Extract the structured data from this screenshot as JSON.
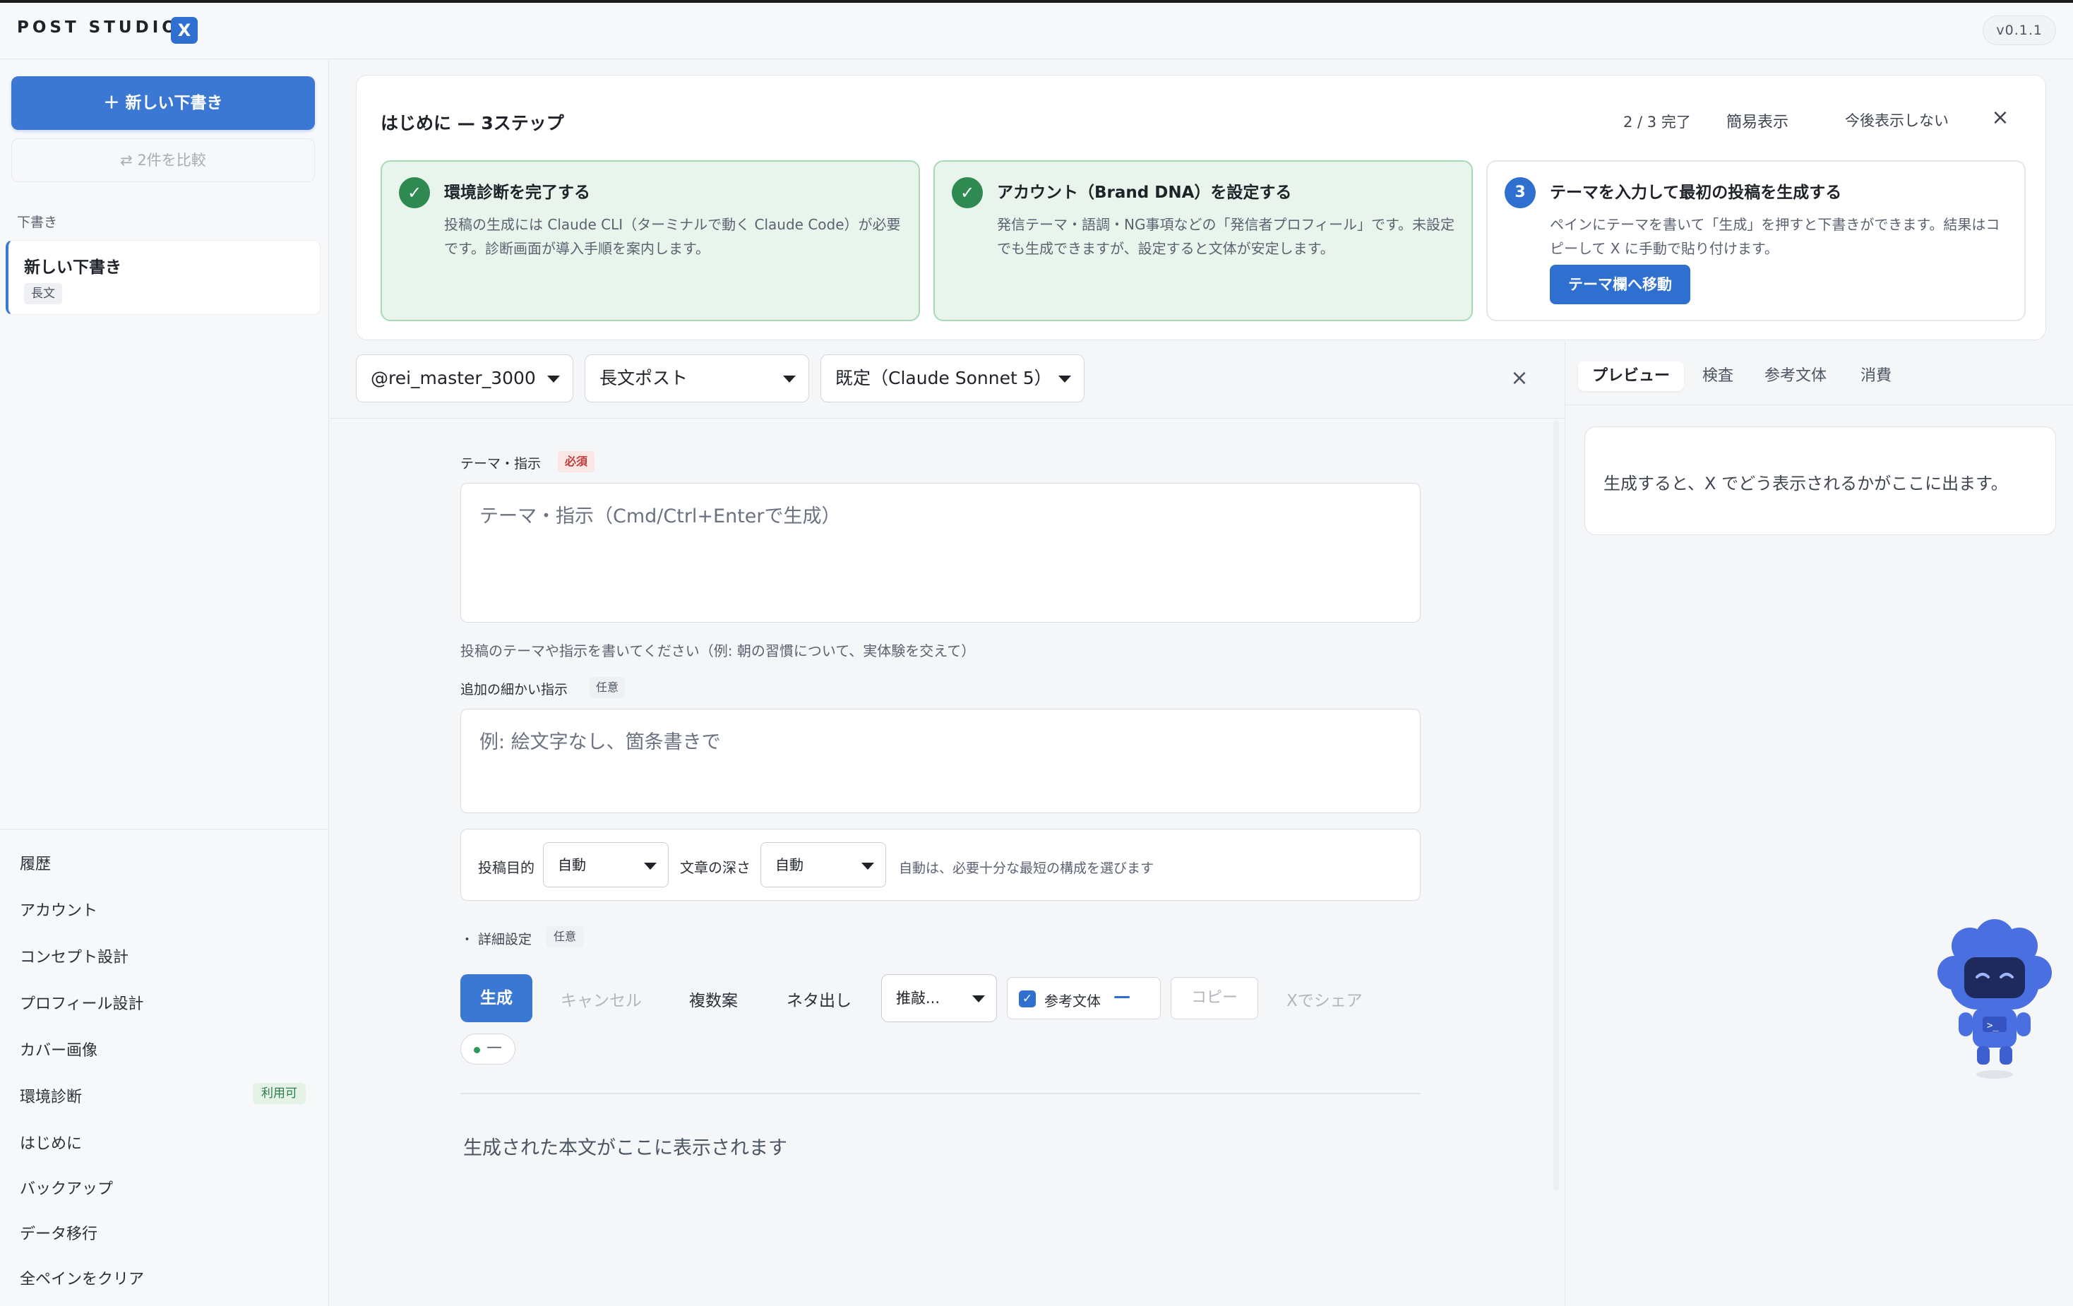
{
  "header": {
    "brand": "POST STUDIO",
    "brand_badge": "X",
    "version": "v0.1.1"
  },
  "sidebar": {
    "new_draft_button": "＋ 新しい下書き",
    "compare_button": "⇄ 2件を比較",
    "drafts_section_label": "下書き",
    "drafts": [
      {
        "title": "新しい下書き",
        "tag": "長文"
      }
    ],
    "nav": [
      {
        "label": "履歴"
      },
      {
        "label": "アカウント"
      },
      {
        "label": "コンセプト設計"
      },
      {
        "label": "プロフィール設計"
      },
      {
        "label": "カバー画像"
      },
      {
        "label": "環境診断",
        "badge": "利用可"
      },
      {
        "label": "はじめに"
      },
      {
        "label": "バックアップ"
      },
      {
        "label": "データ移行"
      },
      {
        "label": "全ペインをクリア"
      }
    ]
  },
  "onboarding": {
    "title": "はじめに — 3ステップ",
    "progress": "2 / 3 完了",
    "simple_view": "簡易表示",
    "dont_show": "今後表示しない",
    "close": "×",
    "steps": [
      {
        "status": "done",
        "icon": "✓",
        "title": "環境診断を完了する",
        "desc": "投稿の生成には Claude CLI（ターミナルで動く Claude Code）が必要です。診断画面が導入手順を案内します。"
      },
      {
        "status": "done",
        "icon": "✓",
        "title": "アカウント（Brand DNA）を設定する",
        "desc": "発信テーマ・語調・NG事項などの「発信者プロフィール」です。未設定でも生成できますが、設定すると文体が安定します。"
      },
      {
        "status": "todo",
        "icon": "3",
        "title": "テーマを入力して最初の投稿を生成する",
        "desc": "ペインにテーマを書いて「生成」を押すと下書きができます。結果はコピーして X に手動で貼り付けます。",
        "button": "テーマ欄へ移動"
      }
    ]
  },
  "toolbar": {
    "account": "@rei_master_3000",
    "post_type": "長文ポスト",
    "model": "既定（Claude Sonnet 5）",
    "close": "×"
  },
  "form": {
    "theme_label": "テーマ・指示",
    "required_badge": "必須",
    "theme_placeholder": "テーマ・指示（Cmd/Ctrl+Enterで生成）",
    "theme_hint": "投稿のテーマや指示を書いてください（例: 朝の習慣について、実体験を交えて）",
    "extra_label": "追加の細かい指示",
    "optional_badge": "任意",
    "extra_placeholder": "例: 絵文字なし、箇条書きで",
    "purpose_label": "投稿目的",
    "purpose_value": "自動",
    "depth_label": "文章の深さ",
    "depth_value": "自動",
    "auto_hint": "自動は、必要十分な最短の構成を選びます",
    "advanced_label": "・ 詳細設定",
    "advanced_badge": "任意"
  },
  "actions": {
    "generate": "生成",
    "cancel": "キャンセル",
    "multiple": "複数案",
    "ideas": "ネタ出し",
    "refine_select": "推敲...",
    "reference_label": "参考文体",
    "reference_value": "—",
    "copy": "コピー",
    "share": "Xでシェア",
    "status": "—"
  },
  "output": {
    "placeholder": "生成された本文がここに表示されます"
  },
  "right_panel": {
    "tabs": [
      "プレビュー",
      "検査",
      "参考文体",
      "消費"
    ],
    "active_tab": "プレビュー",
    "preview_text": "生成すると、X でどう表示されるかがここに出ます。"
  },
  "colors": {
    "accent": "#3b78d4",
    "success": "#2f8a52",
    "success_bg": "#e8f4ec",
    "required": "#c23b3b",
    "mascot": "#4a6fe0"
  }
}
